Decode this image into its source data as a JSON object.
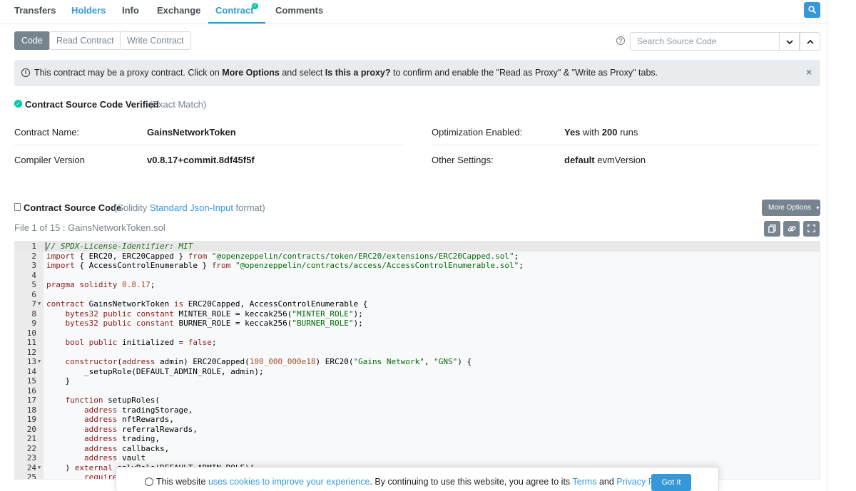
{
  "tabs": [
    {
      "label": "Transfers"
    },
    {
      "label": "Holders"
    },
    {
      "label": "Info"
    },
    {
      "label": "Exchange"
    },
    {
      "label": "Contract"
    },
    {
      "label": "Comments"
    }
  ],
  "sub_tabs": [
    {
      "label": "Code"
    },
    {
      "label": "Read Contract"
    },
    {
      "label": "Write Contract"
    }
  ],
  "search": {
    "placeholder": "Search Source Code"
  },
  "alert": {
    "t1": "This contract may be a proxy contract. Click on ",
    "b1": "More Options",
    "t2": " and select ",
    "b2": "Is this a proxy?",
    "t3": " to confirm and enable the \"Read as Proxy\" & \"Write as Proxy\" tabs.",
    "close": "×"
  },
  "verified": {
    "title": "Contract Source Code Verified",
    "subtitle": "(Exact Match)"
  },
  "info": {
    "contract_name_label": "Contract Name:",
    "contract_name": "GainsNetworkToken",
    "compiler_label": "Compiler Version",
    "compiler": "v0.8.17+commit.8df45f5f",
    "optimization_label": "Optimization Enabled:",
    "optimization_yes": "Yes",
    "optimization_with": " with ",
    "optimization_runs": "200",
    "optimization_runs_word": " runs",
    "other_label": "Other Settings:",
    "other_default": "default",
    "other_evm": " evmVersion"
  },
  "source": {
    "title": "Contract Source Code",
    "sub_open": "(Solidity ",
    "sub_link": "Standard Json-Input",
    "sub_close": " format)",
    "more_options": "More Options",
    "file_label": "File 1 of 15 : GainsNetworkToken.sol"
  },
  "code_lines": [
    {
      "n": "1",
      "t": "// SPDX-License-Identifier: MIT"
    },
    {
      "n": "2",
      "t": "import { ERC20, ERC20Capped } from \"@openzeppelin/contracts/token/ERC20/extensions/ERC20Capped.sol\";"
    },
    {
      "n": "3",
      "t": "import { AccessControlEnumerable } from \"@openzeppelin/contracts/access/AccessControlEnumerable.sol\";"
    },
    {
      "n": "4",
      "t": ""
    },
    {
      "n": "5",
      "t": "pragma solidity 0.8.17;"
    },
    {
      "n": "6",
      "t": ""
    },
    {
      "n": "7",
      "t": "contract GainsNetworkToken is ERC20Capped, AccessControlEnumerable {"
    },
    {
      "n": "8",
      "t": "    bytes32 public constant MINTER_ROLE = keccak256(\"MINTER_ROLE\");"
    },
    {
      "n": "9",
      "t": "    bytes32 public constant BURNER_ROLE = keccak256(\"BURNER_ROLE\");"
    },
    {
      "n": "10",
      "t": ""
    },
    {
      "n": "11",
      "t": "    bool public initialized = false;"
    },
    {
      "n": "12",
      "t": ""
    },
    {
      "n": "13",
      "t": "    constructor(address admin) ERC20Capped(100_000_000e18) ERC20(\"Gains Network\", \"GNS\") {"
    },
    {
      "n": "14",
      "t": "        _setupRole(DEFAULT_ADMIN_ROLE, admin);"
    },
    {
      "n": "15",
      "t": "    }"
    },
    {
      "n": "16",
      "t": ""
    },
    {
      "n": "17",
      "t": "    function setupRoles("
    },
    {
      "n": "18",
      "t": "        address tradingStorage,"
    },
    {
      "n": "19",
      "t": "        address nftRewards,"
    },
    {
      "n": "20",
      "t": "        address referralRewards,"
    },
    {
      "n": "21",
      "t": "        address trading,"
    },
    {
      "n": "22",
      "t": "        address callbacks,"
    },
    {
      "n": "23",
      "t": "        address vault"
    },
    {
      "n": "24",
      "t": "    ) external onlyRole(DEFAULT_ADMIN_ROLE){"
    },
    {
      "n": "25",
      "t": "        require("
    }
  ],
  "cookie": {
    "t1": "This website ",
    "link1": "uses cookies to improve your experience",
    "t2": ". By continuing to use this website, you agree to its ",
    "link2": "Terms",
    "t3": " and ",
    "link3": "Privacy Policy",
    "t4": ".",
    "button": "Got It"
  }
}
